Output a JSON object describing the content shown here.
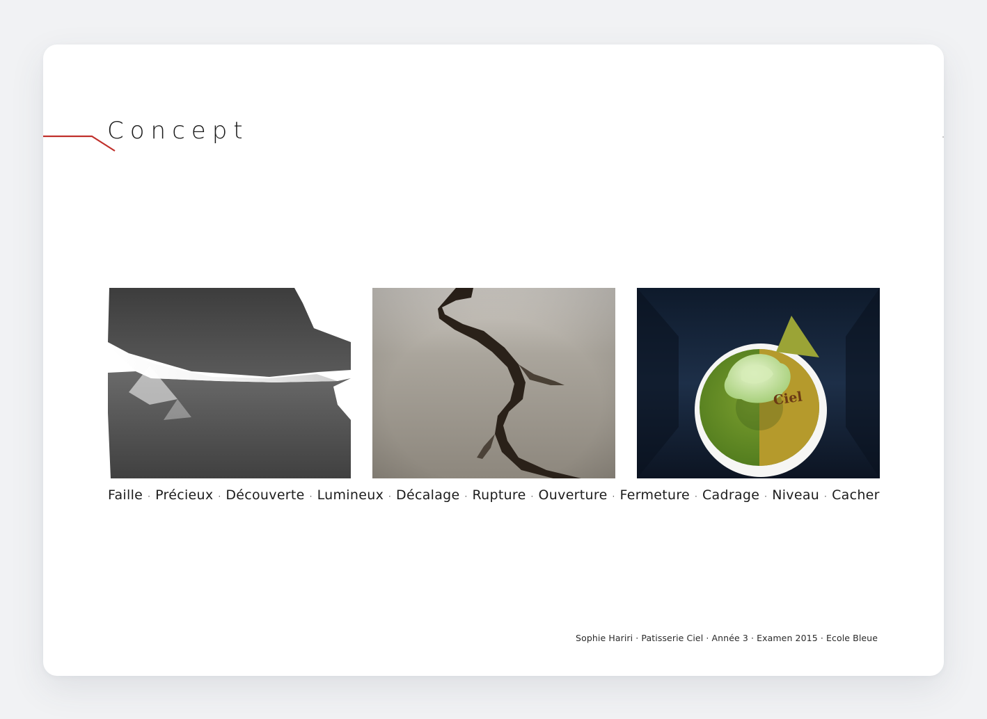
{
  "slide": {
    "title": "Concept",
    "accent_color": "#c0302b",
    "keywords": [
      "Faille",
      "Précieux",
      "Découverte",
      "Lumineux",
      "Décalage",
      "Rupture",
      "Ouverture",
      "Fermeture",
      "Cadrage",
      "Niveau",
      "Cacher"
    ],
    "separator": "·",
    "footer": "Sophie Hariri · Patisserie Ciel · Année 3 · Examen 2015 · Ecole Bleue",
    "images": [
      {
        "name": "folded-stone-fault-image"
      },
      {
        "name": "cracked-ground-image"
      },
      {
        "name": "matcha-cake-image",
        "cake_label": "Ciel"
      }
    ]
  }
}
